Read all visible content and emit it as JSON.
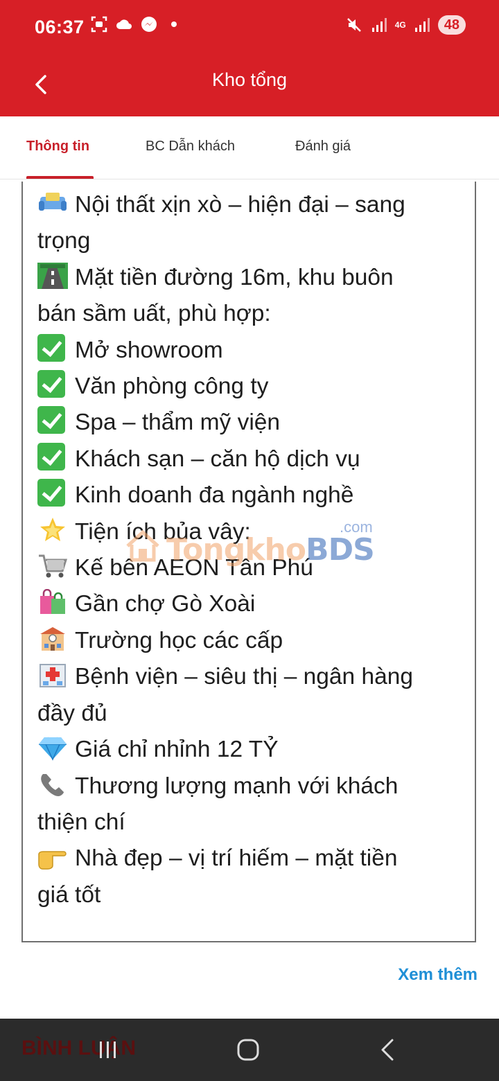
{
  "status": {
    "time": "06:37",
    "network": "4G",
    "battery": "48"
  },
  "appbar": {
    "title": "Kho tổng"
  },
  "tabs": [
    {
      "label": "Thông tin",
      "active": true
    },
    {
      "label": "BC Dẫn khách",
      "active": false
    },
    {
      "label": "Đánh giá",
      "active": false
    }
  ],
  "content": {
    "lines": [
      "Nội thất xịn xò – hiện đại – sang",
      "trọng",
      "Mặt tiền đường 16m, khu buôn",
      "bán sầm uất, phù hợp:",
      "Mở showroom",
      "Văn phòng công ty",
      "Spa – thẩm mỹ viện",
      "Khách sạn – căn hộ dịch vụ",
      "Kinh doanh đa ngành nghề",
      "Tiện ích bủa vây:",
      "Kế bên AEON Tân Phú",
      "Gần chợ Gò Xoài",
      "Trường học các cấp",
      "Bệnh viện – siêu thị – ngân hàng",
      "đầy đủ",
      "Giá chỉ nhỉnh 12 TỶ",
      "Thương lượng mạnh với khách",
      "thiện chí",
      "Nhà đẹp – vị trí hiếm – mặt tiền",
      "giá tốt"
    ]
  },
  "watermark": {
    "part1": "Tongkho",
    "part2": "BDS",
    "suffix": ".com"
  },
  "actions": {
    "see_more": "Xem thêm"
  },
  "comments": {
    "label": "BÌNH LUẬN"
  },
  "colors": {
    "brand": "#d71f26",
    "tab_active": "#c8202a",
    "link": "#1f8fd6",
    "check": "#3fb64b"
  }
}
